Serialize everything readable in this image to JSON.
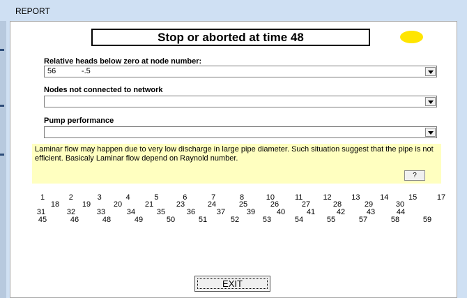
{
  "window": {
    "title": "REPORT"
  },
  "status": {
    "text": "Stop or aborted at time  48",
    "indicator_color": "#ffe500"
  },
  "relative_heads": {
    "label": "Relative heads below zero at node number:",
    "value": "56            -.5"
  },
  "nodes_not_connected": {
    "label": "Nodes not connected to network",
    "value": ""
  },
  "pump_performance": {
    "label": "Pump performance",
    "value": ""
  },
  "info": {
    "text": "Laminar flow may happen due to very low discharge in large pipe diameter. Such situation suggest that the pipe is not efficient. Basicaly Laminar flow depend on Raynold number.",
    "help_label": "?"
  },
  "node_rows": [
    [
      "1",
      "2",
      "3",
      "4",
      "5",
      "6",
      "7",
      "8",
      "10",
      "11",
      "12",
      "13",
      "14",
      "15",
      "17"
    ],
    [
      "18",
      "19",
      "20",
      "21",
      "23",
      "24",
      "25",
      "26",
      "27",
      "28",
      "29",
      "30"
    ],
    [
      "31",
      "32",
      "33",
      "34",
      "35",
      "36",
      "37",
      "39",
      "40",
      "41",
      "42",
      "43",
      "44"
    ],
    [
      "45",
      "46",
      "48",
      "49",
      "50",
      "51",
      "52",
      "53",
      "54",
      "55",
      "57",
      "58",
      "59"
    ]
  ],
  "exit_button": {
    "label": "EXIT"
  }
}
